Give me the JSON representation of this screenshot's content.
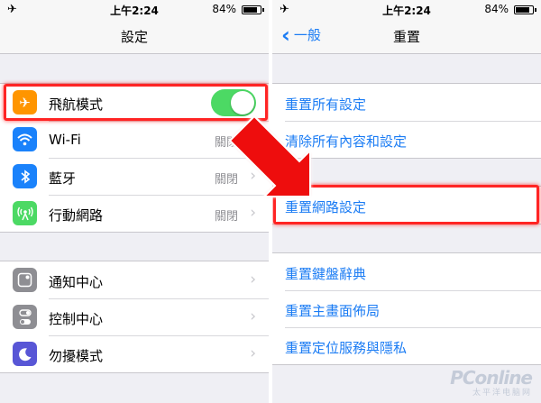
{
  "status_bar": {
    "left": {
      "time": "上午2:24",
      "battery": "84%",
      "battery_level": 0.84
    },
    "right": {
      "time": "上午2:24",
      "battery": "84%",
      "battery_level": 0.84
    }
  },
  "left_screen": {
    "title": "設定",
    "group1": [
      {
        "label": "飛航模式",
        "icon": "airplane-icon",
        "icon_color": "#ff9500",
        "toggle_on": true
      },
      {
        "label": "Wi-Fi",
        "icon": "wifi-icon",
        "icon_color": "#1a82fb",
        "value": "關閉"
      },
      {
        "label": "藍牙",
        "icon": "bluetooth-icon",
        "icon_color": "#1a82fb",
        "value": "關閉"
      },
      {
        "label": "行動網路",
        "icon": "cellular-icon",
        "icon_color": "#4cd964",
        "value": "關閉"
      }
    ],
    "group2": [
      {
        "label": "通知中心",
        "icon": "notification-center-icon",
        "icon_color": "#8e8e93"
      },
      {
        "label": "控制中心",
        "icon": "control-center-icon",
        "icon_color": "#8e8e93"
      },
      {
        "label": "勿擾模式",
        "icon": "do-not-disturb-icon",
        "icon_color": "#5856d6"
      }
    ]
  },
  "right_screen": {
    "back_label": "一般",
    "title": "重置",
    "group1": [
      "重置所有設定",
      "清除所有內容和設定"
    ],
    "group2": [
      "重置網路設定"
    ],
    "group3": [
      "重置鍵盤辭典",
      "重置主畫面佈局",
      "重置定位服務與隱私"
    ]
  },
  "watermark": {
    "logo": "PConline",
    "sub": "太平洋电脑网"
  },
  "colors": {
    "accent": "#1b7cf4",
    "highlight": "#ff2424",
    "toggle_on": "#4cd964"
  }
}
